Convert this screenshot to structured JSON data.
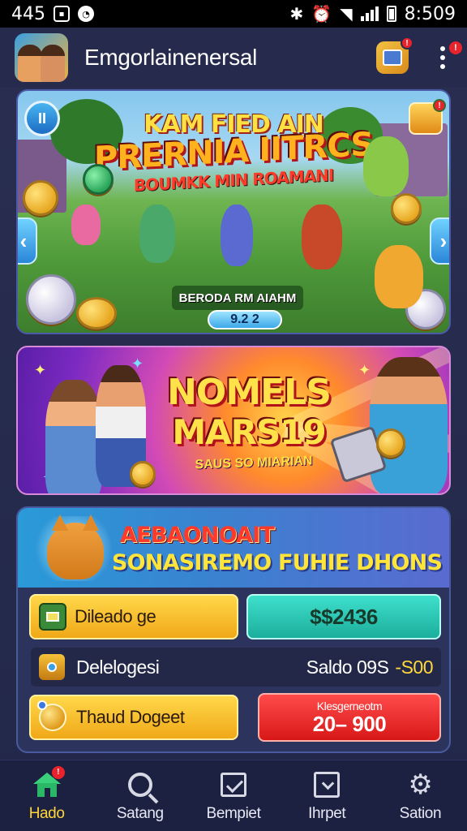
{
  "status_bar": {
    "left_text": "445",
    "time": "8:509"
  },
  "header": {
    "app_title": "Emgorlainenersal",
    "gift_badge": "!",
    "menu_badge": "!"
  },
  "hero": {
    "line1": "KAM FIED AIN",
    "line2": "PRERNIA IITRCS",
    "line3": "BOUMKK MIN ROAMANI",
    "caption": "BERODA RM AIAHM",
    "counter": "9.2 2",
    "pause_label": "II",
    "badge": "!",
    "prev_arrow": "‹",
    "next_arrow": "›"
  },
  "promo": {
    "line1": "NOMELS",
    "line2": "MARS19",
    "subtitle": "SAUS SO MIARIAN"
  },
  "panel": {
    "title1": "AEBAONOAIT",
    "title2": "SONASIREMO FUHIE DHONS",
    "btn_left_label": "Dileado ge",
    "btn_right_label": "$$2436",
    "row_label": "Delelogesi",
    "saldo_label": "Saldo 09S",
    "saldo_value": "-S00",
    "btn_bottom_left_label": "Thaud Dogeet",
    "btn_bottom_right_line1": "Klesgerneotm",
    "btn_bottom_right_line2": "20– 900"
  },
  "bottom_nav": {
    "items": [
      {
        "label": "Hado",
        "icon": "home-icon",
        "active": true,
        "badge": "!"
      },
      {
        "label": "Satang",
        "icon": "search-icon"
      },
      {
        "label": "Bempiet",
        "icon": "edit-icon"
      },
      {
        "label": "Ihrpet",
        "icon": "download-icon"
      },
      {
        "label": "Sation",
        "icon": "gear-icon"
      }
    ]
  },
  "colors": {
    "background": "#232a4a",
    "accent_yellow": "#ffd63a",
    "teal": "#1cae9c",
    "red": "#d81818",
    "active_nav": "#ffd63a"
  }
}
